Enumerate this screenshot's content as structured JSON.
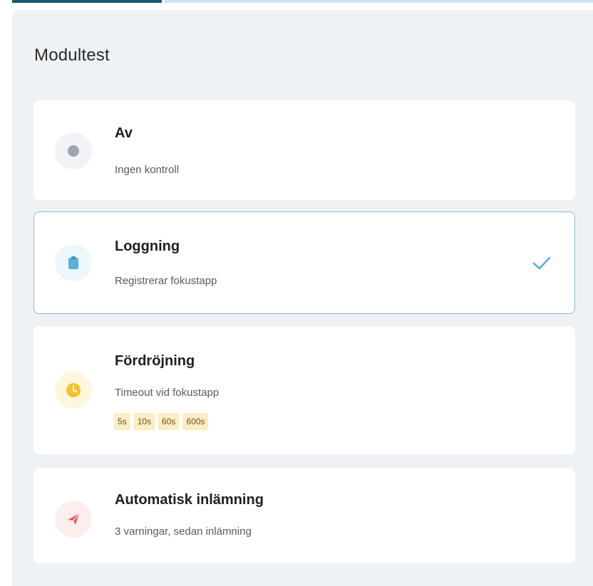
{
  "panel": {
    "title": "Modultest"
  },
  "options": [
    {
      "title": "Av",
      "description": "Ingen kontroll",
      "icon": "dot-icon",
      "selected": false
    },
    {
      "title": "Loggning",
      "description": "Registrerar fokustapp",
      "icon": "clipboard-icon",
      "selected": true
    },
    {
      "title": "Fördröjning",
      "description": "Timeout vid fokustapp",
      "icon": "clock-icon",
      "selected": false,
      "timeouts": [
        "5s",
        "10s",
        "60s",
        "600s"
      ]
    },
    {
      "title": "Automatisk inlämning",
      "description": "3 varningar, sedan inlämning",
      "icon": "send-icon",
      "selected": false
    }
  ],
  "colors": {
    "accent": "#5ab0d8",
    "selected_border": "#86bcd8",
    "panel_background": "#eff2f5",
    "chip_background": "#fbedc4",
    "off_dot": "#9aa6b2",
    "clock": "#f2c230",
    "send": "#e45a5a"
  }
}
